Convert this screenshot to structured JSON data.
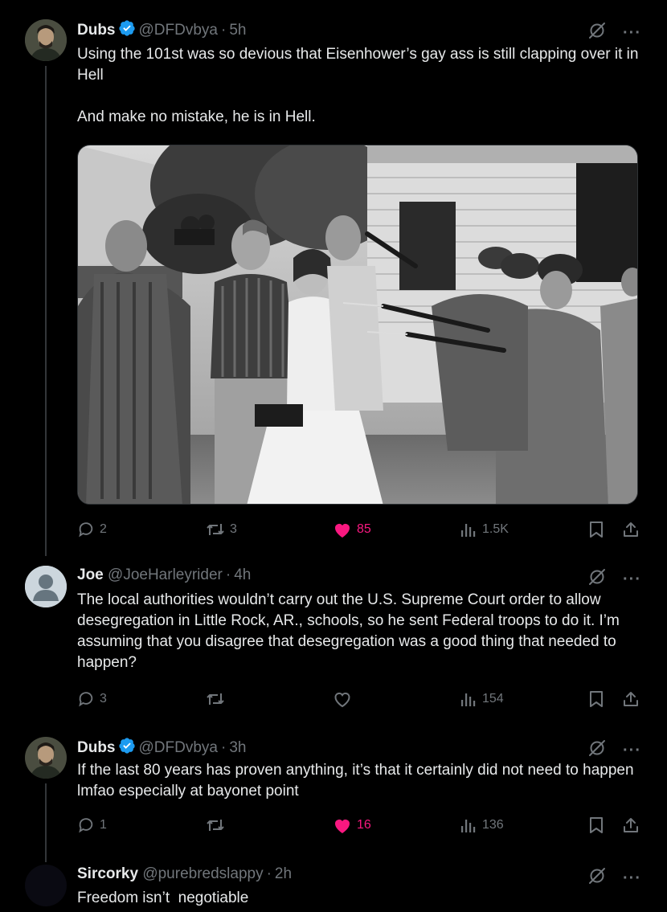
{
  "tweets": [
    {
      "name": "Dubs",
      "handle": "@DFDvbya",
      "time": "5h",
      "verified": true,
      "text": "Using the 101st was so devious that Eisenhower’s gay ass is still clapping over it in Hell\n\nAnd make no mistake, he is in Hell.",
      "replies": "2",
      "reposts": "3",
      "likes": "85",
      "liked": true,
      "views": "1.5K"
    },
    {
      "name": "Joe",
      "handle": "@JoeHarleyrider",
      "time": "4h",
      "verified": false,
      "text": "The local authorities wouldn’t carry out the U.S. Supreme Court order to allow desegregation in Little Rock, AR., schools, so he sent Federal troops to do it. I’m assuming that you disagree that desegregation was a good thing that needed to happen?",
      "replies": "3",
      "reposts": "",
      "likes": "",
      "liked": false,
      "views": "154"
    },
    {
      "name": "Dubs",
      "handle": "@DFDvbya",
      "time": "3h",
      "verified": true,
      "text": "If the last 80 years has proven anything, it’s that it certainly did not need to happen lmfao especially at bayonet point",
      "replies": "1",
      "reposts": "",
      "likes": "16",
      "liked": true,
      "views": "136"
    },
    {
      "name": "Sircorky",
      "handle": "@purebredslappy",
      "time": "2h",
      "verified": false,
      "text": "Freedom isn’t  negotiable"
    }
  ],
  "separator": "·",
  "more_glyph": "···",
  "colors": {
    "like": "#f91880",
    "verified": "#1d9bf0",
    "muted": "#71767b",
    "text": "#e7e9ea"
  }
}
